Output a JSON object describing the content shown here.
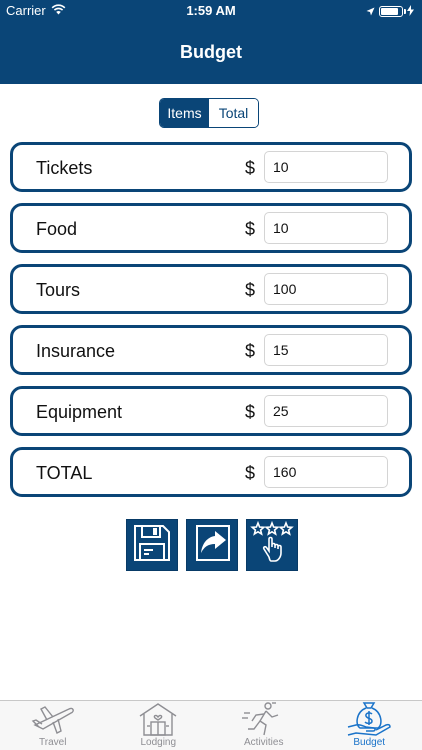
{
  "status_bar": {
    "carrier": "Carrier",
    "time": "1:59 AM",
    "battery_level": 0.92
  },
  "header": {
    "title": "Budget"
  },
  "segmented": {
    "items_label": "Items",
    "total_label": "Total",
    "selected": "Items"
  },
  "currency_symbol": "$",
  "rows": [
    {
      "label": "Tickets",
      "value": "10"
    },
    {
      "label": "Food",
      "value": "10"
    },
    {
      "label": "Tours",
      "value": "100"
    },
    {
      "label": "Insurance",
      "value": "15"
    },
    {
      "label": "Equipment",
      "value": "25"
    },
    {
      "label": "TOTAL",
      "value": "160"
    }
  ],
  "actions": [
    {
      "icon": "save-icon"
    },
    {
      "icon": "share-icon"
    },
    {
      "icon": "rate-icon"
    }
  ],
  "tabbar": {
    "selected": "Budget",
    "tabs": [
      {
        "label": "Travel",
        "icon": "airplane-icon"
      },
      {
        "label": "Lodging",
        "icon": "house-icon"
      },
      {
        "label": "Activities",
        "icon": "runner-icon"
      },
      {
        "label": "Budget",
        "icon": "money-bag-icon"
      }
    ]
  },
  "colors": {
    "primary": "#0a4577",
    "tab_active": "#1a73c9",
    "tab_inactive": "#8e8e93"
  }
}
